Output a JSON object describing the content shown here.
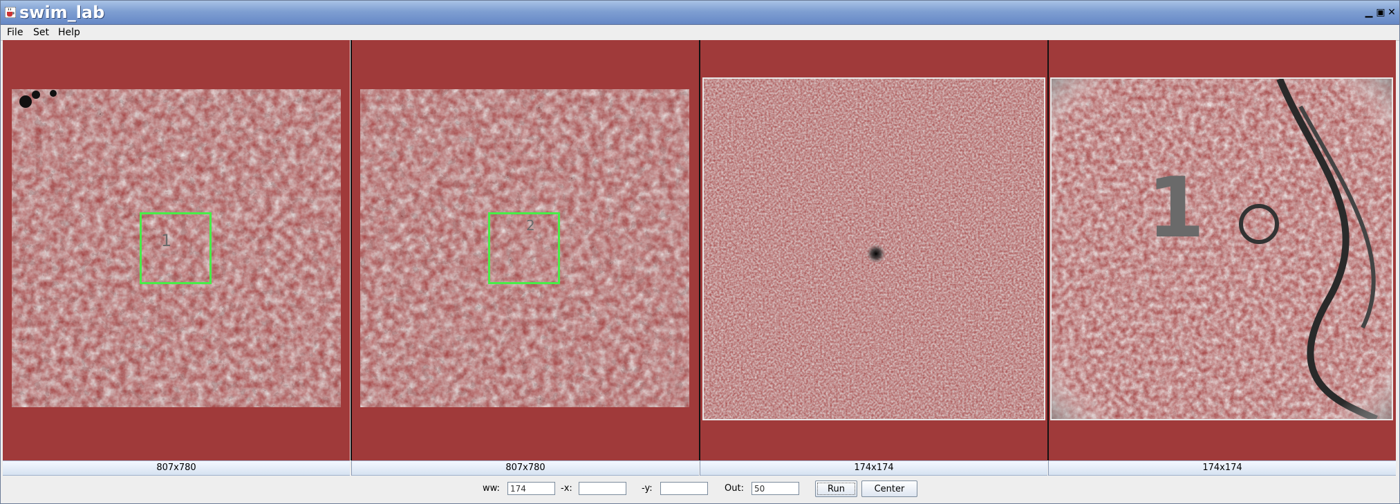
{
  "window": {
    "title": "swim_lab",
    "app_icon": "java-cup-icon"
  },
  "menus": [
    "File",
    "Set",
    "Help"
  ],
  "panels": [
    {
      "size_label": "807x780",
      "roi_label": "1"
    },
    {
      "size_label": "807x780",
      "roi_label": "2"
    },
    {
      "size_label": "174x174"
    },
    {
      "size_label": "174x174",
      "overlay_text": "1"
    }
  ],
  "controls": {
    "ww": {
      "label": "ww:",
      "value": "174"
    },
    "x": {
      "label": "-x:",
      "value": ""
    },
    "y": {
      "label": "-y:",
      "value": ""
    },
    "out": {
      "label": "Out:",
      "value": "50"
    },
    "run_label": "Run",
    "center_label": "Center"
  },
  "colors": {
    "panel_bg": "#a03a3a",
    "roi_box": "#47ee47",
    "titlebar": "#7f9fd2"
  }
}
